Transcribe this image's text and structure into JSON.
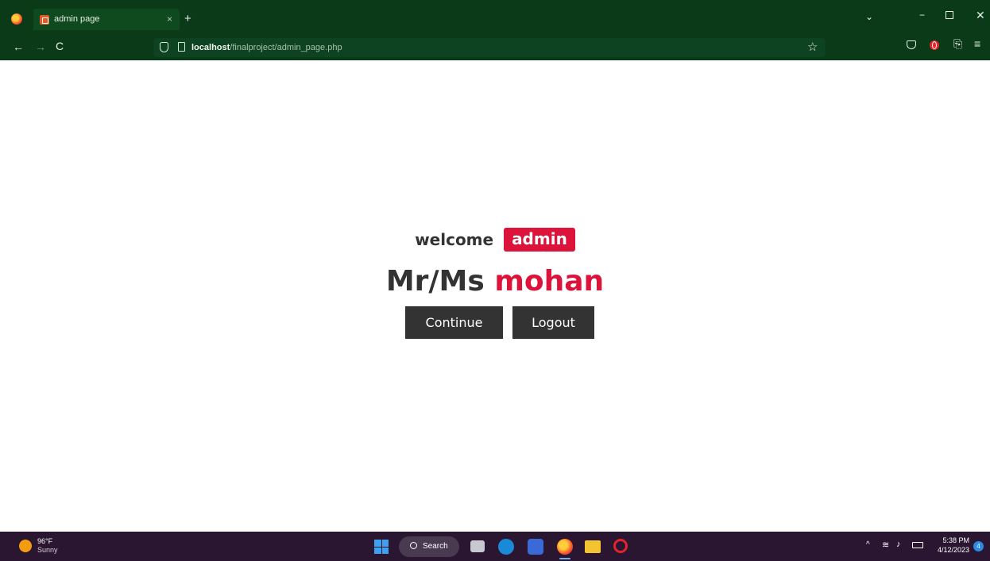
{
  "browser": {
    "tab_title": "admin page",
    "tab_close": "×",
    "new_tab": "+",
    "tabs_dropdown": "⌄",
    "minimize": "−",
    "close": "✕",
    "back": "←",
    "forward": "→",
    "reload": "C",
    "url_host": "localhost",
    "url_path": "/finalproject/admin_page.php",
    "bookmark_star": "☆",
    "share": "⎘",
    "menu": "≡"
  },
  "page": {
    "welcome_text": "welcome",
    "role": "admin",
    "salutation": "Mr/Ms",
    "username": "mohan",
    "continue_label": "Continue",
    "logout_label": "Logout"
  },
  "taskbar": {
    "weather_temp": "96°F",
    "weather_condition": "Sunny",
    "search_label": "Search",
    "time": "5:38 PM",
    "date": "4/12/2023",
    "notification_count": "4",
    "tray_up": "^",
    "wifi": "≋",
    "volume": "♪"
  },
  "colors": {
    "chrome_bg": "#0a3a17",
    "accent": "#dc143c",
    "button_bg": "#333333",
    "taskbar_bg": "#2a1630"
  },
  "icons": [
    "firefox-icon",
    "shield-icon",
    "page-icon",
    "star-icon",
    "pocket-icon",
    "opera-icon",
    "share-icon",
    "menu-icon",
    "windows-start-icon",
    "search-icon",
    "edge-icon",
    "store-icon",
    "file-explorer-icon"
  ]
}
